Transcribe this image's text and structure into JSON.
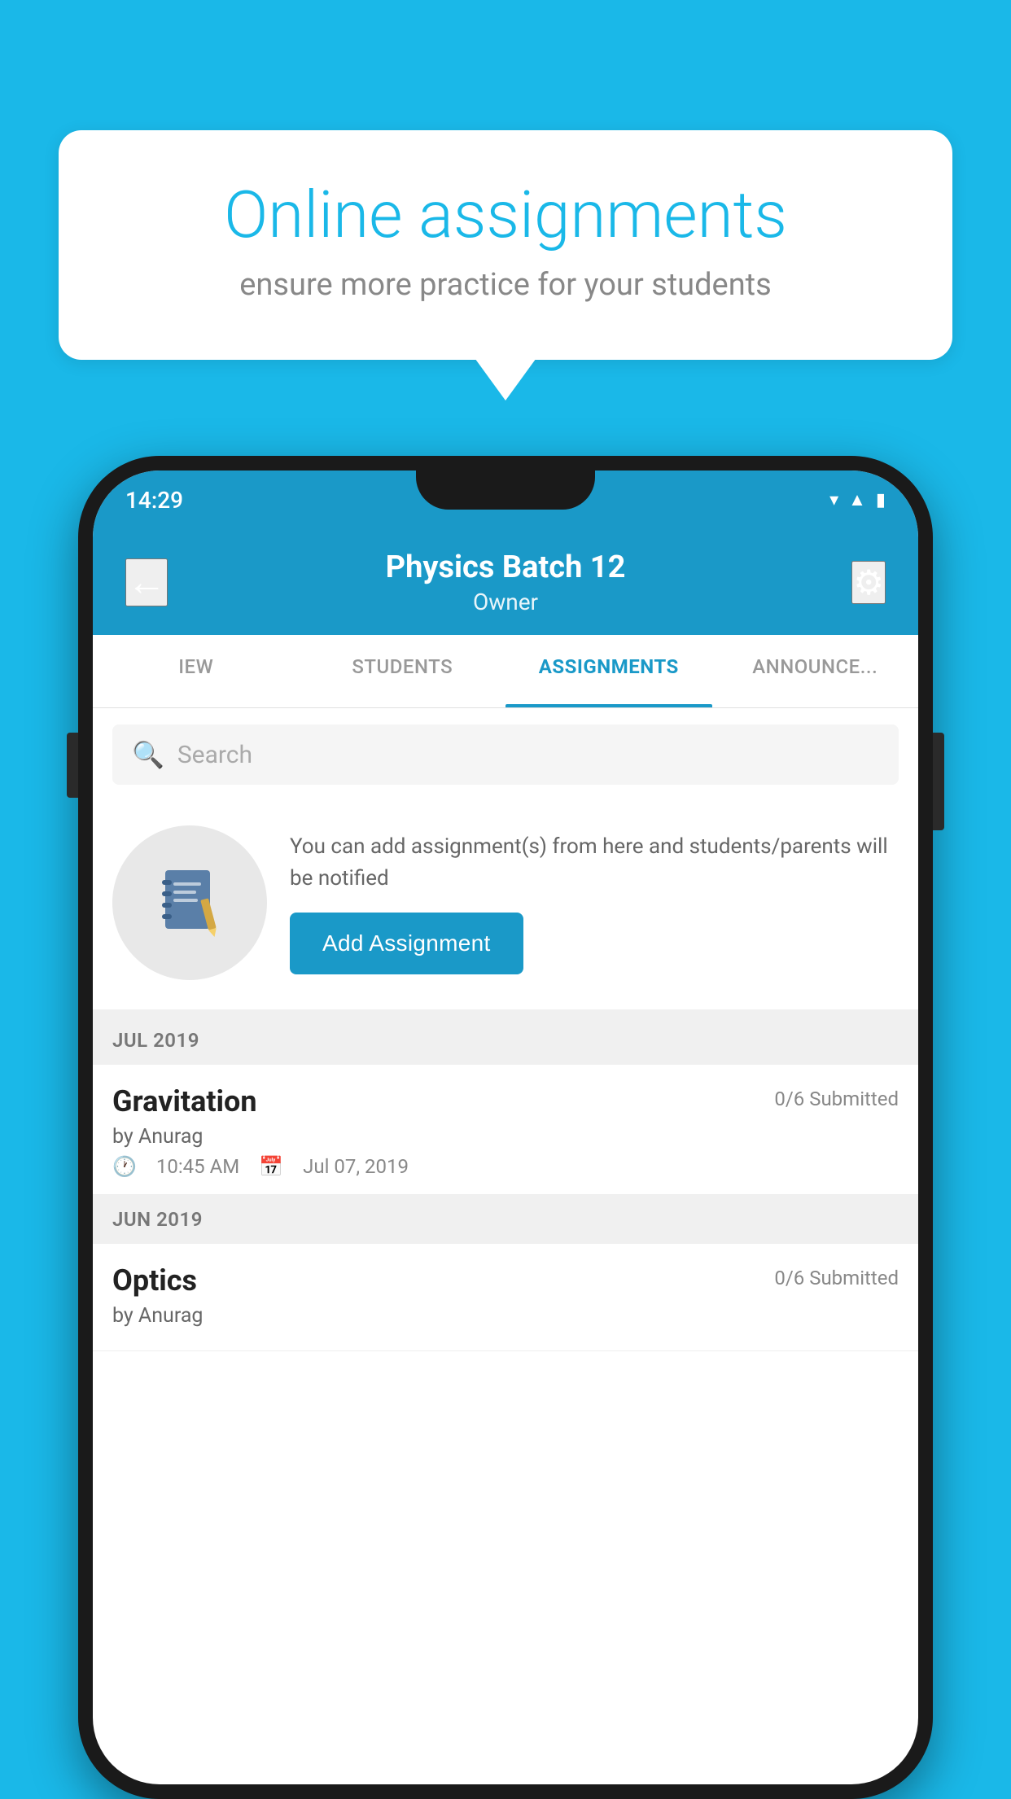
{
  "background_color": "#1ab8e8",
  "speech_bubble": {
    "title": "Online assignments",
    "subtitle": "ensure more practice for your students"
  },
  "status_bar": {
    "time": "14:29",
    "wifi_icon": "wifi",
    "signal_icon": "signal",
    "battery_icon": "battery"
  },
  "header": {
    "title": "Physics Batch 12",
    "subtitle": "Owner",
    "back_label": "←",
    "settings_label": "⚙"
  },
  "tabs": [
    {
      "id": "iew",
      "label": "IEW",
      "active": false
    },
    {
      "id": "students",
      "label": "STUDENTS",
      "active": false
    },
    {
      "id": "assignments",
      "label": "ASSIGNMENTS",
      "active": true
    },
    {
      "id": "announcements",
      "label": "ANNOUNCEMENTS",
      "active": false
    }
  ],
  "search": {
    "placeholder": "Search"
  },
  "add_assignment_section": {
    "description": "You can add assignment(s) from here and students/parents will be notified",
    "button_label": "Add Assignment"
  },
  "sections": [
    {
      "label": "JUL 2019",
      "assignments": [
        {
          "name": "Gravitation",
          "submitted": "0/6 Submitted",
          "by": "by Anurag",
          "time": "10:45 AM",
          "date": "Jul 07, 2019"
        }
      ]
    },
    {
      "label": "JUN 2019",
      "assignments": [
        {
          "name": "Optics",
          "submitted": "0/6 Submitted",
          "by": "by Anurag",
          "time": "",
          "date": ""
        }
      ]
    }
  ]
}
